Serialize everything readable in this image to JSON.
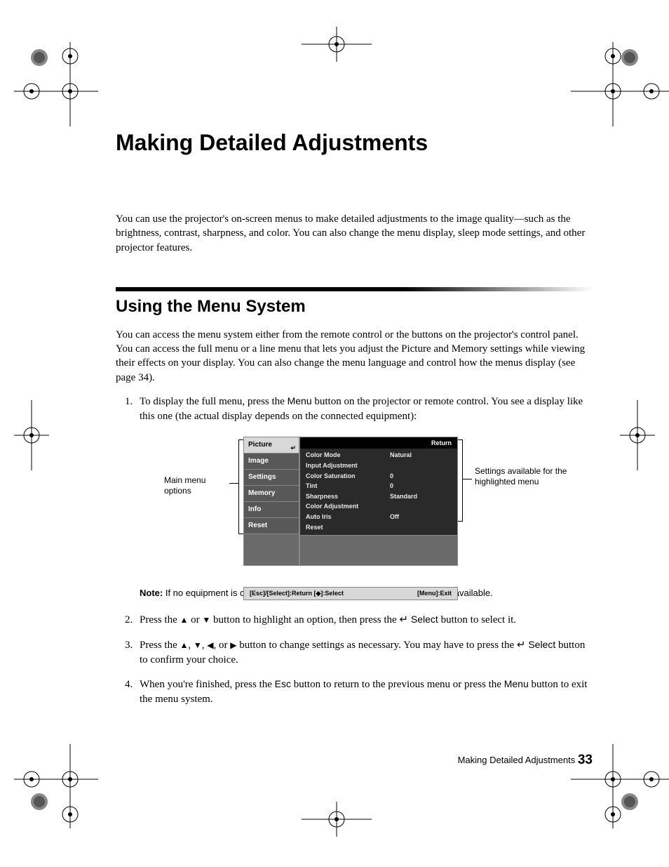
{
  "title": "Making Detailed Adjustments",
  "intro": "You can use the projector's on-screen menus to make detailed adjustments to the image quality—such as the brightness, contrast, sharpness, and color. You can also change the menu display, sleep mode settings, and other projector features.",
  "section": {
    "heading": "Using the Menu System",
    "para": "You can access the menu system either from the remote control or the buttons on the projector's control panel. You can access the full menu or a line menu that lets you adjust the Picture and Memory settings while viewing their effects on your display. You can also change the menu language and control how the menus display (see page 34)."
  },
  "steps": {
    "s1a": "To display the full menu, press the ",
    "s1_menu": "Menu",
    "s1b": " button on the projector or remote control. You see a display like this one (the actual display depends on the connected equipment):",
    "s2a": "Press the ",
    "s2b": " or ",
    "s2c": " button to highlight an option, then press the ",
    "s2_select": " Select",
    "s2d": " button to select it.",
    "s3a": "Press the ",
    "s3b": ", ",
    "s3c": ", ",
    "s3d": ", or ",
    "s3e": " button to change settings as necessary. You may have to press the ",
    "s3_select": " Select",
    "s3f": " button to confirm your choice.",
    "s4a": "When you're finished, press the ",
    "s4_esc": "Esc",
    "s4b": " button to return to the previous menu or press the ",
    "s4_menu": "Menu",
    "s4c": " button to exit the menu system."
  },
  "figure": {
    "callout_left": "Main menu options",
    "callout_right": "Settings available for the highlighted menu",
    "tabs": [
      "Picture",
      "Image",
      "Settings",
      "Memory",
      "Info",
      "Reset"
    ],
    "return_label": "Return",
    "rows": [
      {
        "k": "Color Mode",
        "v": "Natural"
      },
      {
        "k": "Input Adjustment",
        "v": ""
      },
      {
        "k": "Color Saturation",
        "v": "0"
      },
      {
        "k": "Tint",
        "v": "0"
      },
      {
        "k": "Sharpness",
        "v": "Standard"
      },
      {
        "k": "Color Adjustment",
        "v": ""
      },
      {
        "k": "Auto Iris",
        "v": "Off"
      },
      {
        "k": "Reset",
        "v": ""
      }
    ],
    "bottom_left": "[Esc]/[Select]:Return [◆]:Select",
    "bottom_right": "[Menu]:Exit"
  },
  "note": {
    "label": "Note:",
    "text": " If no equipment is connected to the projector, some options may not be available."
  },
  "footer": {
    "text": "Making Detailed Adjustments ",
    "page": "33"
  },
  "glyphs": {
    "up": "▲",
    "down": "▼",
    "left": "◀",
    "right": "▶",
    "enter": "↵"
  }
}
